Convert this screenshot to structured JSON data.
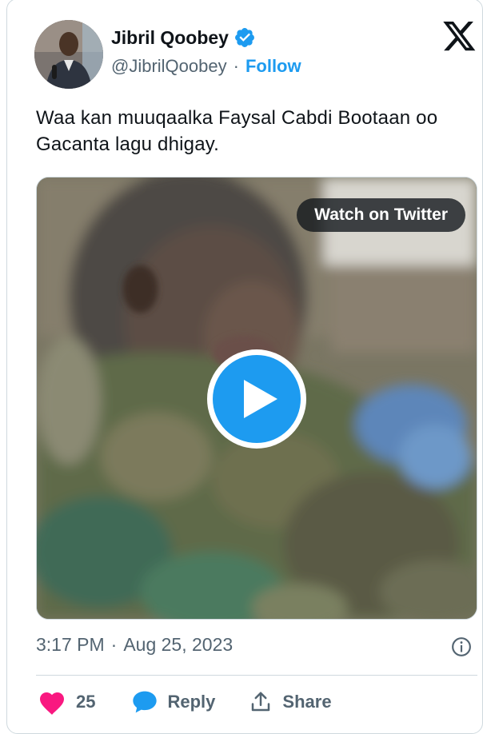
{
  "author": {
    "name": "Jibril Qoobey",
    "handle": "@JibrilQoobey",
    "separator": "·",
    "follow_label": "Follow",
    "verified_icon": "verified-badge-icon"
  },
  "platform_icon": "x-logo-icon",
  "tweet": {
    "text": "Waa kan muuqaalka Faysal Cabdi Bootaan oo Gacanta lagu dhigay."
  },
  "media": {
    "type": "video",
    "watch_label": "Watch on Twitter",
    "play_icon": "play-icon"
  },
  "meta": {
    "time": "3:17 PM",
    "separator": "·",
    "date": "Aug 25, 2023",
    "info_icon": "info-icon"
  },
  "actions": {
    "like_count": "25",
    "reply_label": "Reply",
    "share_label": "Share"
  },
  "colors": {
    "accent": "#1d9bf0",
    "like": "#f91880",
    "text": "#0f1419",
    "muted": "#536471",
    "border": "#cfd9de"
  }
}
